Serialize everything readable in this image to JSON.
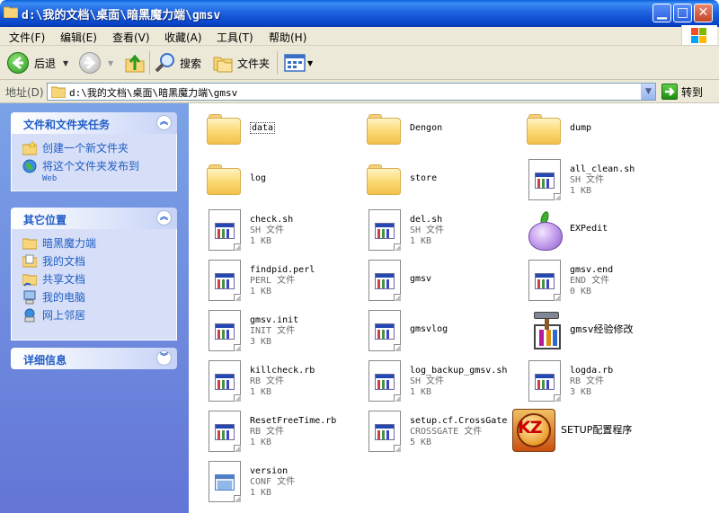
{
  "window": {
    "title": "d:\\我的文档\\桌面\\暗黑魔力端\\gmsv"
  },
  "menu": [
    {
      "label": "文件(F)"
    },
    {
      "label": "编辑(E)"
    },
    {
      "label": "查看(V)"
    },
    {
      "label": "收藏(A)"
    },
    {
      "label": "工具(T)"
    },
    {
      "label": "帮助(H)"
    }
  ],
  "toolbar": {
    "back": "后退",
    "search": "搜索",
    "folders": "文件夹"
  },
  "address": {
    "label": "地址(D)",
    "value": "d:\\我的文档\\桌面\\暗黑魔力端\\gmsv",
    "go": "转到"
  },
  "left": {
    "tasks": {
      "title": "文件和文件夹任务",
      "links": [
        {
          "label": "创建一个新文件夹",
          "sub": ""
        },
        {
          "label": "将这个文件夹发布到",
          "sub": "Web"
        }
      ]
    },
    "places": {
      "title": "其它位置",
      "links": [
        {
          "label": "暗黑魔力端"
        },
        {
          "label": "我的文档"
        },
        {
          "label": "共享文档"
        },
        {
          "label": "我的电脑"
        },
        {
          "label": "网上邻居"
        }
      ]
    },
    "details": {
      "title": "详细信息"
    }
  },
  "files": [
    {
      "name": "data",
      "type": "",
      "size": "",
      "icon": "folder-icon"
    },
    {
      "name": "Dengon",
      "type": "",
      "size": "",
      "icon": "folder-icon"
    },
    {
      "name": "dump",
      "type": "",
      "size": "",
      "icon": "folder-icon"
    },
    {
      "name": "log",
      "type": "",
      "size": "",
      "icon": "folder-icon"
    },
    {
      "name": "store",
      "type": "",
      "size": "",
      "icon": "folder-icon"
    },
    {
      "name": "all_clean.sh",
      "type": "SH 文件",
      "size": "1 KB",
      "icon": "file-icon"
    },
    {
      "name": "check.sh",
      "type": "SH 文件",
      "size": "1 KB",
      "icon": "file-icon"
    },
    {
      "name": "del.sh",
      "type": "SH 文件",
      "size": "1 KB",
      "icon": "file-icon"
    },
    {
      "name": "EXPedit",
      "type": "",
      "size": "",
      "icon": "onion-icon"
    },
    {
      "name": "findpid.perl",
      "type": "PERL 文件",
      "size": "1 KB",
      "icon": "file-icon"
    },
    {
      "name": "gmsv",
      "type": "",
      "size": "",
      "icon": "file-icon"
    },
    {
      "name": "gmsv.end",
      "type": "END 文件",
      "size": "0 KB",
      "icon": "file-icon"
    },
    {
      "name": "gmsv.init",
      "type": "INIT 文件",
      "size": "3 KB",
      "icon": "file-icon"
    },
    {
      "name": "gmsvlog",
      "type": "",
      "size": "",
      "icon": "file-icon"
    },
    {
      "name": "gmsv经验修改",
      "type": "",
      "size": "",
      "icon": "tool-app-icon"
    },
    {
      "name": "killcheck.rb",
      "type": "RB 文件",
      "size": "1 KB",
      "icon": "file-icon"
    },
    {
      "name": "log_backup_gmsv.sh",
      "type": "SH 文件",
      "size": "1 KB",
      "icon": "file-icon"
    },
    {
      "name": "logda.rb",
      "type": "RB 文件",
      "size": "3 KB",
      "icon": "file-icon"
    },
    {
      "name": "ResetFreeTime.rb",
      "type": "RB 文件",
      "size": "1 KB",
      "icon": "file-icon"
    },
    {
      "name": "setup.cf.CrossGate",
      "type": "CROSSGATE 文件",
      "size": "5 KB",
      "icon": "file-icon"
    },
    {
      "name": "SETUP配置程序",
      "type": "",
      "size": "",
      "icon": "kz-app-icon"
    },
    {
      "name": "version",
      "type": "CONF 文件",
      "size": "1 KB",
      "icon": "conf-file-icon"
    }
  ]
}
